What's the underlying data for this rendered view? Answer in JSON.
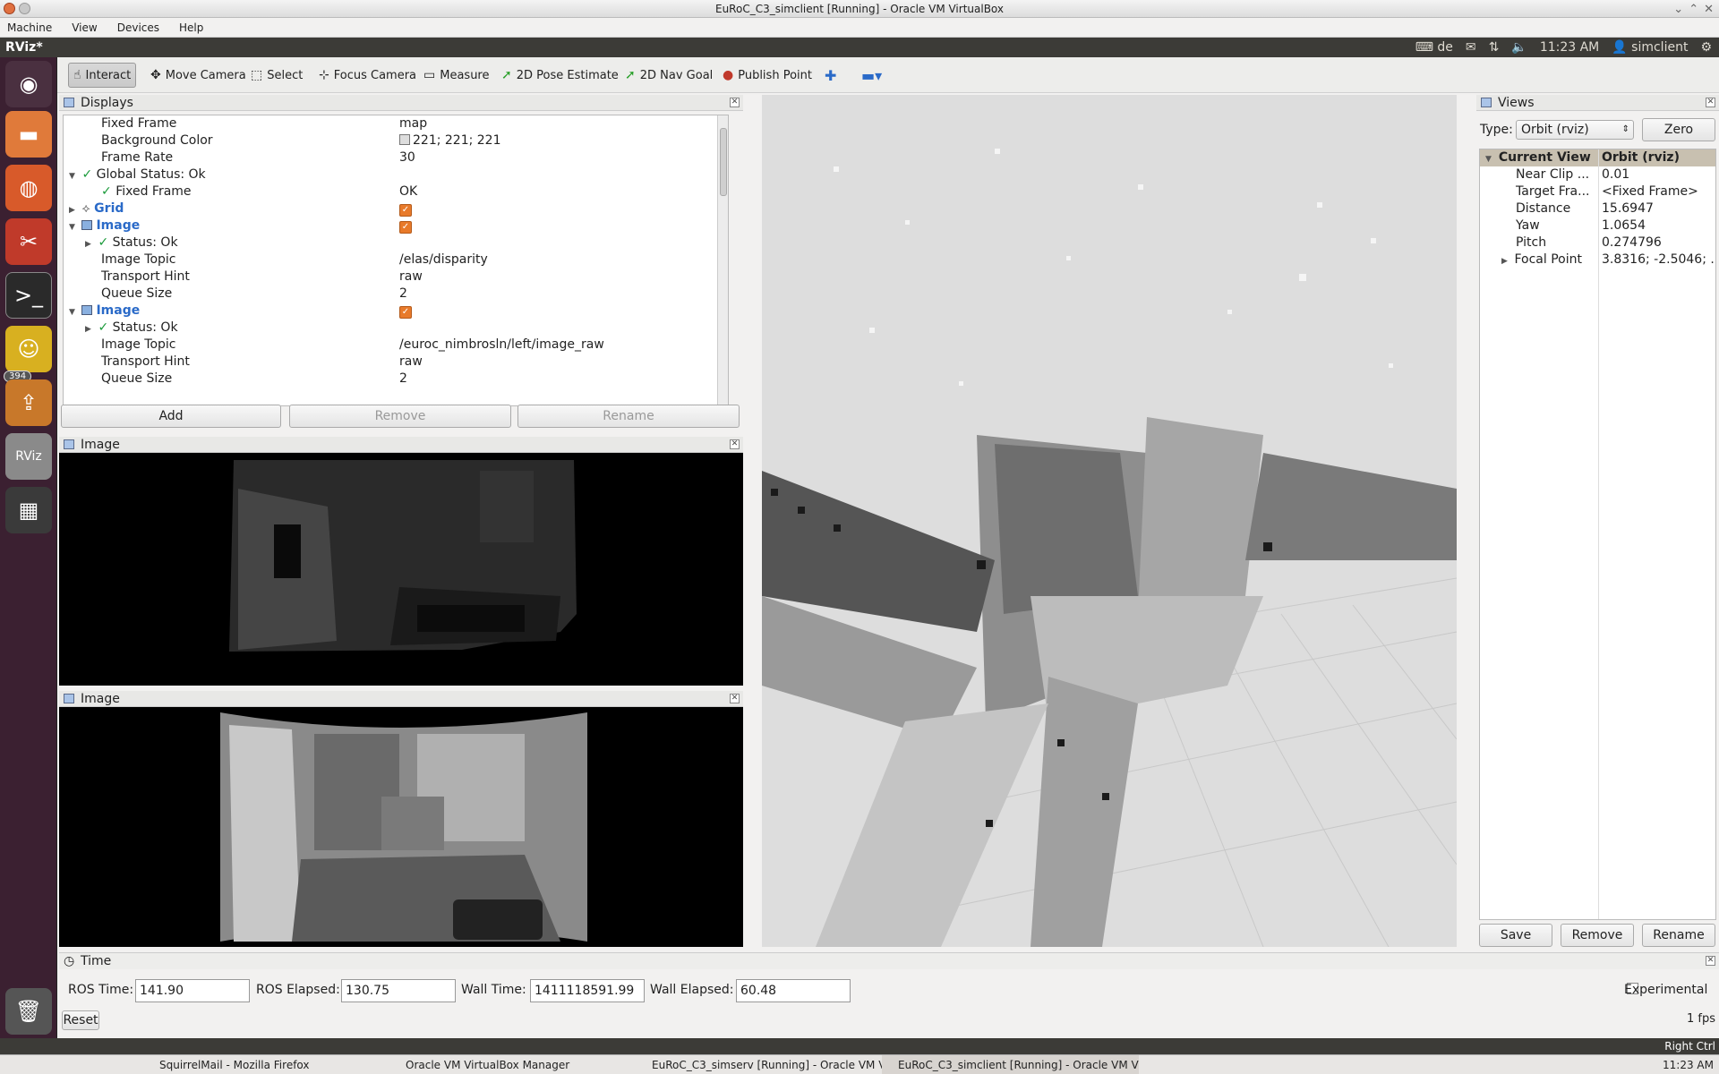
{
  "vbox": {
    "title": "EuRoC_C3_simclient [Running] - Oracle VM VirtualBox",
    "menu": [
      "Machine",
      "View",
      "Devices",
      "Help"
    ],
    "host_key": "Right Ctrl"
  },
  "panel": {
    "app_name": "RViz*",
    "keyboard": "de",
    "time": "11:23 AM",
    "user": "simclient"
  },
  "launcher": {
    "badge": "394"
  },
  "toolbar": {
    "interact": "Interact",
    "move_camera": "Move Camera",
    "select": "Select",
    "focus_camera": "Focus Camera",
    "measure": "Measure",
    "pose_estimate": "2D Pose Estimate",
    "nav_goal": "2D Nav Goal",
    "publish_point": "Publish Point"
  },
  "displays": {
    "title": "Displays",
    "fixed_frame_k": "Fixed Frame",
    "fixed_frame_v": "map",
    "bg_color_k": "Background Color",
    "bg_color_v": "221; 221; 221",
    "frame_rate_k": "Frame Rate",
    "frame_rate_v": "30",
    "global_status": "Global Status: Ok",
    "gs_fixed_frame_k": "Fixed Frame",
    "gs_fixed_frame_v": "OK",
    "grid": "Grid",
    "image1": "Image",
    "image1_status": "Status: Ok",
    "image1_topic_k": "Image Topic",
    "image1_topic_v": "/elas/disparity",
    "image1_hint_k": "Transport Hint",
    "image1_hint_v": "raw",
    "image1_queue_k": "Queue Size",
    "image1_queue_v": "2",
    "image2": "Image",
    "image2_status": "Status: Ok",
    "image2_topic_k": "Image Topic",
    "image2_topic_v": "/euroc_nimbrosln/left/image_raw",
    "image2_hint_k": "Transport Hint",
    "image2_hint_v": "raw",
    "image2_queue_k": "Queue Size",
    "image2_queue_v": "2",
    "add": "Add",
    "remove": "Remove",
    "rename": "Rename"
  },
  "image_panels": {
    "top_title": "Image",
    "bottom_title": "Image"
  },
  "views": {
    "title": "Views",
    "type_label": "Type:",
    "type_value": "Orbit (rviz)",
    "zero": "Zero",
    "current_view_k": "Current View",
    "current_view_v": "Orbit (rviz)",
    "near_clip_k": "Near Clip ...",
    "near_clip_v": "0.01",
    "target_k": "Target Fra...",
    "target_v": "<Fixed Frame>",
    "distance_k": "Distance",
    "distance_v": "15.6947",
    "yaw_k": "Yaw",
    "yaw_v": "1.0654",
    "pitch_k": "Pitch",
    "pitch_v": "0.274796",
    "focal_k": "Focal Point",
    "focal_v": "3.8316; -2.5046; ...",
    "save": "Save",
    "remove": "Remove",
    "rename": "Rename"
  },
  "time": {
    "title": "Time",
    "ros_time_label": "ROS Time:",
    "ros_time": "141.90",
    "ros_elapsed_label": "ROS Elapsed:",
    "ros_elapsed": "130.75",
    "wall_time_label": "Wall Time:",
    "wall_time": "1411118591.99",
    "wall_elapsed_label": "Wall Elapsed:",
    "wall_elapsed": "60.48",
    "experimental": "Experimental",
    "reset": "Reset",
    "fps": "1 fps"
  },
  "taskbar": {
    "t1": "SquirrelMail - Mozilla Firefox",
    "t2": "Oracle VM VirtualBox Manager",
    "t3": "EuRoC_C3_simserv [Running] - Oracle VM Vi",
    "t4": "EuRoC_C3_simclient [Running] - Oracle VM V",
    "clock": "11:23 AM"
  }
}
